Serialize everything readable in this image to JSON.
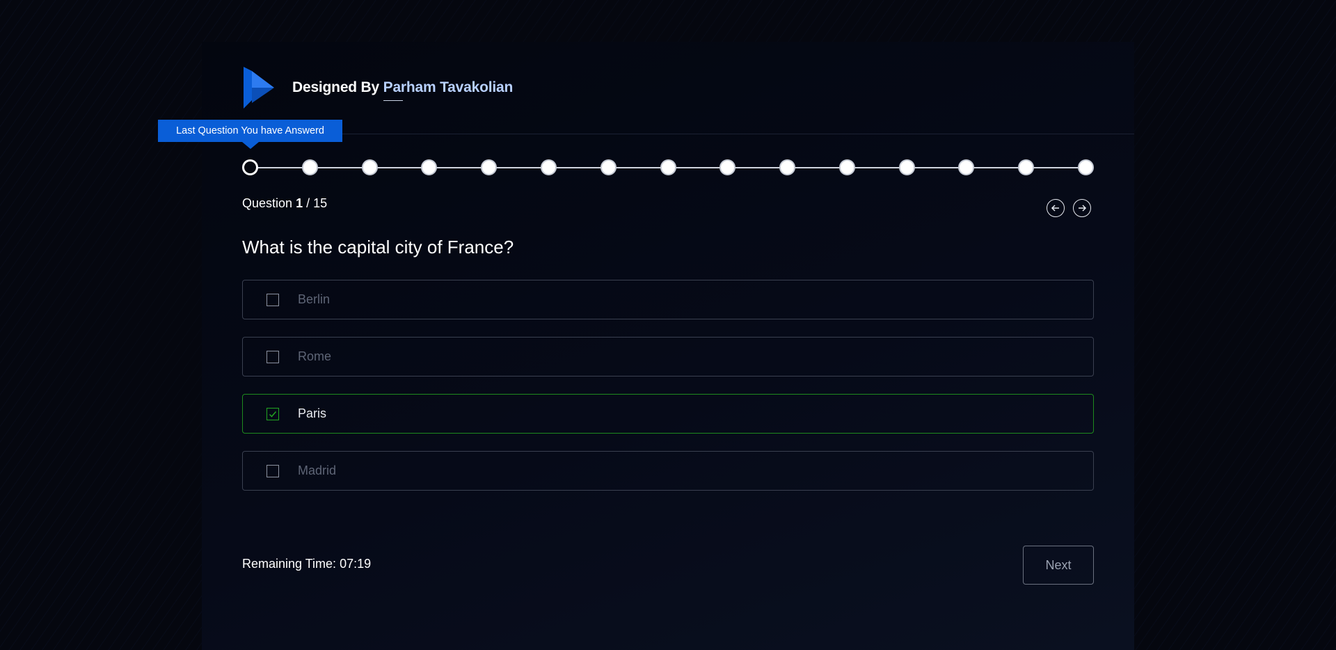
{
  "header": {
    "brand_prefix": "Designed By",
    "author": "Parham Tavakolian",
    "logo_icon": "play-logo-icon",
    "accent_color": "#0a5ed7"
  },
  "tooltip": {
    "text": "Last Question You have Answerd"
  },
  "stepper": {
    "total": 15,
    "current": 1
  },
  "question": {
    "label": "Question",
    "number": "1",
    "total_text": "/ 15",
    "text": "What is the capital city of France?"
  },
  "nav": {
    "prev_icon": "arrow-left-circle-icon",
    "next_icon": "arrow-right-circle-icon"
  },
  "options": [
    {
      "label": "Berlin",
      "selected": false
    },
    {
      "label": "Rome",
      "selected": false
    },
    {
      "label": "Paris",
      "selected": true
    },
    {
      "label": "Madrid",
      "selected": false
    }
  ],
  "footer": {
    "timer_label": "Remaining Time:",
    "timer_value": "07:19",
    "next_label": "Next"
  },
  "colors": {
    "selected_border": "#1e8a1e",
    "selected_check": "#22a522"
  }
}
